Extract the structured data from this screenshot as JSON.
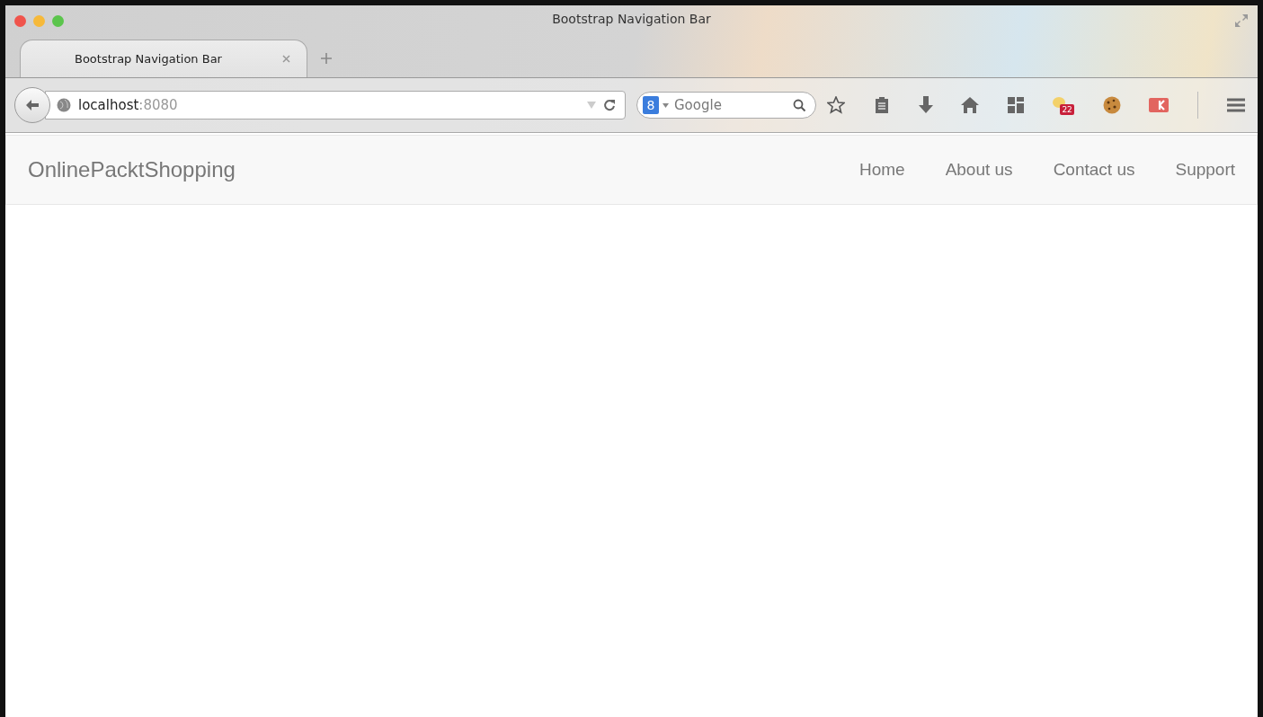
{
  "window": {
    "title": "Bootstrap Navigation Bar"
  },
  "tabs": [
    {
      "label": "Bootstrap Navigation Bar",
      "selected": true
    }
  ],
  "address_bar": {
    "url": "**localhost**:8080"
  },
  "search": {
    "engine_mark": "8",
    "placeholder": "Google"
  },
  "toolbar": {
    "calendar_badge": "22"
  },
  "navbar": {
    "brand": "OnlinePacktShopping",
    "links": [
      {
        "label": "Home"
      },
      {
        "label": "About us"
      },
      {
        "label": "Contact us"
      },
      {
        "label": "Support"
      }
    ]
  }
}
